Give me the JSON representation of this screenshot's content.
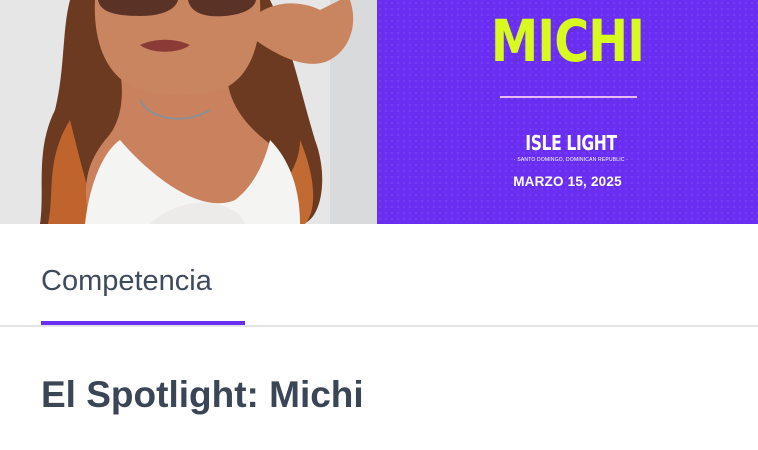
{
  "hero": {
    "promo": {
      "title": "MICHI",
      "logo": {
        "main": "ISLE LIGHT",
        "sub": "· SANTO DOMINGO, DOMINICAN REPUBLIC ·"
      },
      "date": "MARZO 15, 2025",
      "colors": {
        "background": "#6a2ef2",
        "title": "#d8fa1f",
        "rule": "#e9b9f2"
      }
    }
  },
  "tabs": [
    {
      "label": "Competencia",
      "active": true
    }
  ],
  "tab_indicator_color": "#6a2ef2",
  "main": {
    "heading": "El Spotlight: Michi"
  }
}
